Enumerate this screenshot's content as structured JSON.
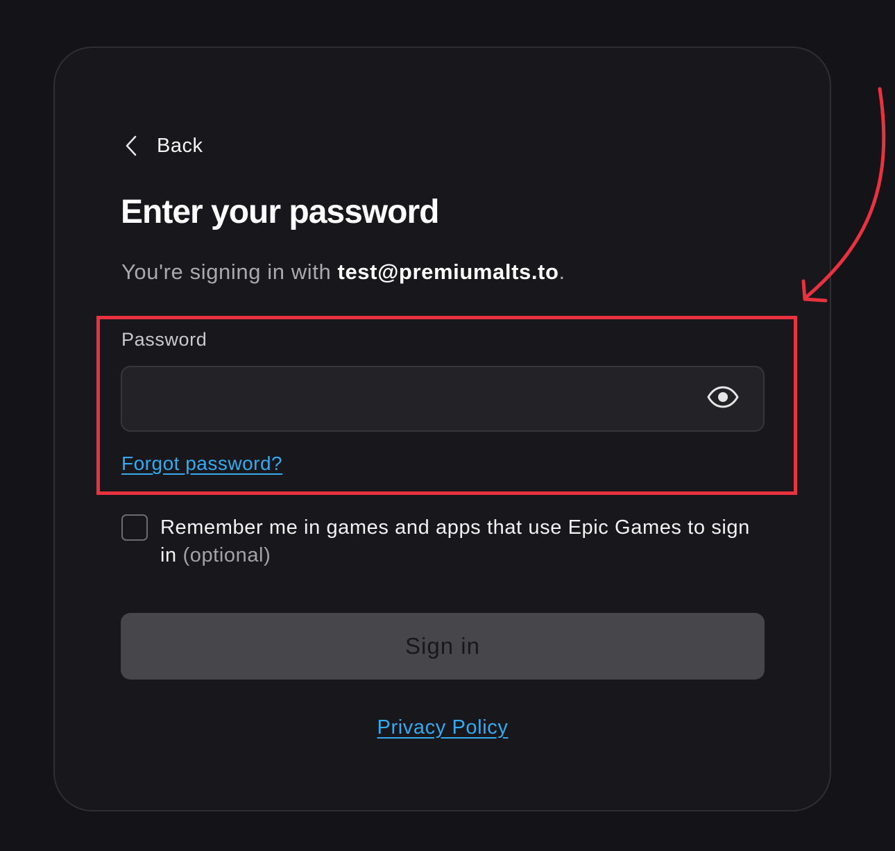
{
  "back": {
    "label": "Back",
    "icon": "chevron-left-icon"
  },
  "title": "Enter your password",
  "subtitle": {
    "prefix": "You're signing in with ",
    "email": "test@premiumalts.to",
    "suffix": "."
  },
  "password_field": {
    "label": "Password",
    "value": "",
    "placeholder": "",
    "toggle_icon": "eye-icon"
  },
  "forgot_password": "Forgot password?",
  "remember_me": {
    "checked": false,
    "text": "Remember me in games and apps that use Epic Games to sign in",
    "optional": "(optional)"
  },
  "sign_in_label": "Sign in",
  "privacy_policy": "Privacy Policy",
  "annotation": {
    "color": "#e8323f",
    "shapes": [
      "highlight-rectangle",
      "curved-arrow"
    ]
  },
  "colors": {
    "background": "#141418",
    "card": "#18181c",
    "link": "#36a9f0",
    "button_disabled": "#46464b"
  }
}
